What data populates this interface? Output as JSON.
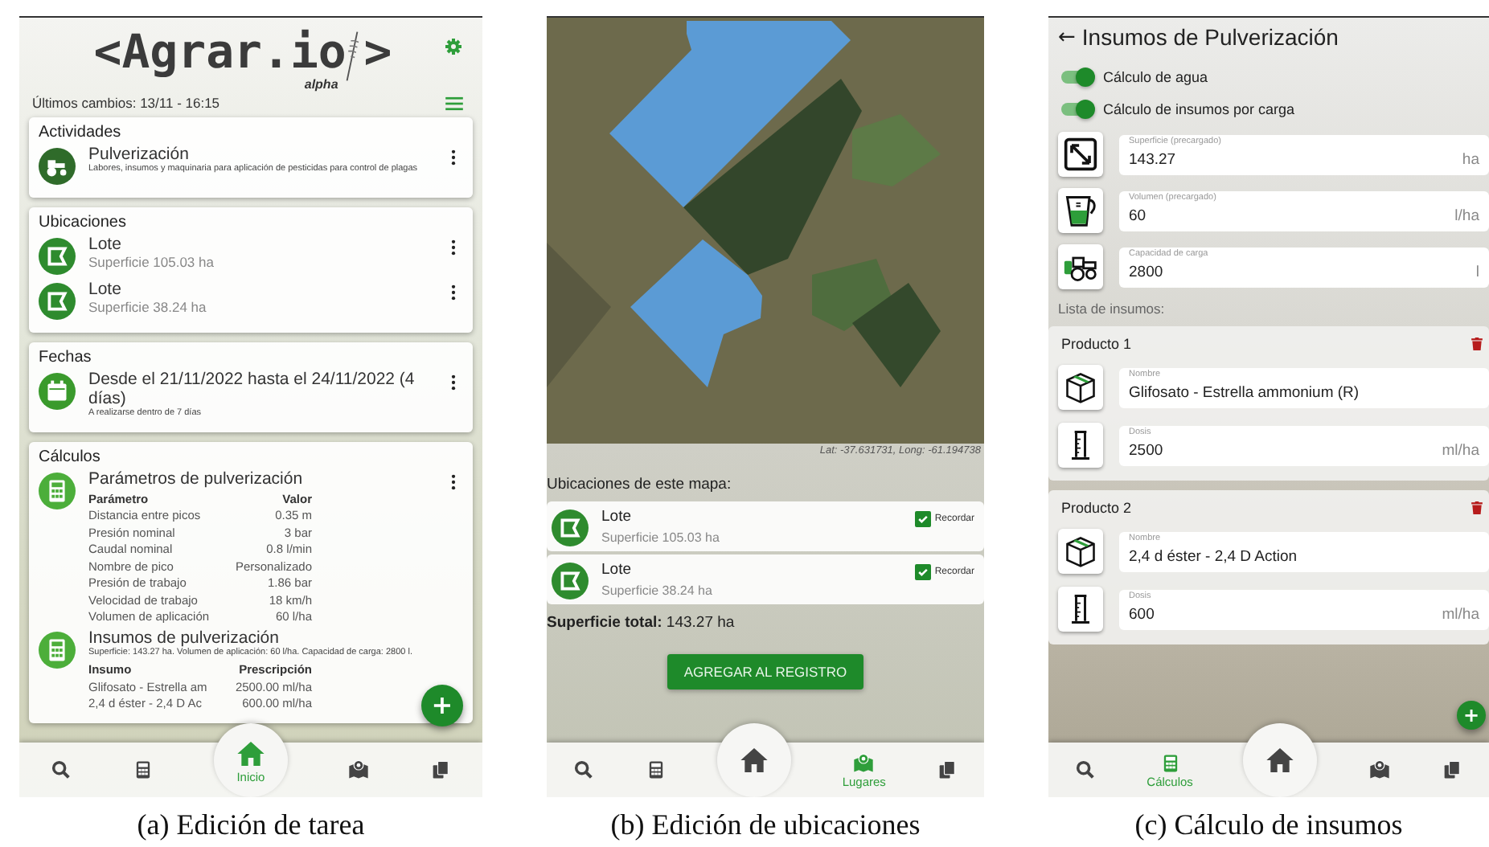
{
  "panel_a": {
    "caption": "(a) Edición de tarea",
    "logo": {
      "text": "<Agrar.io",
      "tag": "alpha",
      "close": ">"
    },
    "last_changes": "Últimos cambios: 13/11 - 16:15",
    "cards": [
      {
        "title": "Actividades",
        "items": [
          {
            "kind": "tractor",
            "title": "Pulverización",
            "note": "Labores, insumos y maquinaria para aplicación de pesticidas para control de plagas",
            "menu": true
          }
        ]
      },
      {
        "title": "Ubicaciones",
        "items": [
          {
            "kind": "location",
            "title": "Lote",
            "subtitle": "Superficie 105.03 ha",
            "menu": true
          },
          {
            "kind": "location",
            "title": "Lote",
            "subtitle": "Superficie 38.24 ha",
            "menu": true
          }
        ]
      },
      {
        "title": "Fechas",
        "items": [
          {
            "kind": "calendar",
            "title": "Desde el 21/11/2022 hasta el 24/11/2022 (4 días)",
            "note": "A realizarse dentro de 7 días",
            "menu": true
          }
        ]
      },
      {
        "title": "Cálculos",
        "items": [
          {
            "kind": "calculator",
            "title": "Parámetros de pulverización",
            "menu": true,
            "table": {
              "columns": [
                "Parámetro",
                "Valor"
              ],
              "rows": [
                [
                  "Distancia entre picos",
                  "0.35 m"
                ],
                [
                  "Presión nominal",
                  "3 bar"
                ],
                [
                  "Caudal nominal",
                  "0.8 l/min"
                ],
                [
                  "Nombre de pico",
                  "Personalizado"
                ],
                [
                  "Presión de trabajo",
                  "1.86 bar"
                ],
                [
                  "Velocidad de trabajo",
                  "18 km/h"
                ],
                [
                  "Volumen de aplicación",
                  "60 l/ha"
                ]
              ]
            }
          },
          {
            "kind": "calculator",
            "title": "Insumos de pulverización",
            "note": "Superficie: 143.27 ha. Volumen de aplicación: 60 l/ha. Capacidad de carga: 2800 l.",
            "menu": false,
            "table": {
              "columns": [
                "Insumo",
                "Prescripción"
              ],
              "rows": [
                [
                  "Glifosato - Estrella am",
                  "2500.00 ml/ha"
                ],
                [
                  "2,4 d éster - 2,4 D Ac",
                  "600.00 ml/ha"
                ]
              ]
            }
          }
        ]
      }
    ],
    "fab": "+",
    "nav": [
      {
        "kind": "search",
        "selected": false
      },
      {
        "kind": "calculator",
        "selected": false
      },
      {
        "kind": "home",
        "selected": true,
        "label": "Inicio"
      },
      {
        "kind": "map",
        "selected": false
      },
      {
        "kind": "documents",
        "selected": false
      }
    ]
  },
  "panel_b": {
    "caption": "(b) Edición de ubicaciones",
    "coordinates": "Lat: -37.631731, Long: -61.194738",
    "heading": "Ubicaciones de este mapa:",
    "locations": [
      {
        "title": "Lote",
        "subtitle": "Superficie 105.03 ha",
        "checkbox": "Recordar",
        "checked": true
      },
      {
        "title": "Lote",
        "subtitle": "Superficie 38.24 ha",
        "checkbox": "Recordar",
        "checked": true
      }
    ],
    "total": "**Superficie total:** 143.27 ha",
    "button": "AGREGAR AL REGISTRO",
    "nav": [
      {
        "kind": "search",
        "selected": false
      },
      {
        "kind": "calculator",
        "selected": false
      },
      {
        "kind": "home",
        "selected": false
      },
      {
        "kind": "map",
        "selected": true,
        "label": "Lugares"
      },
      {
        "kind": "documents",
        "selected": false
      }
    ]
  },
  "panel_c": {
    "caption": "(c) Cálculo de insumos",
    "back": "←",
    "title": "Insumos de Pulverización",
    "toggles": [
      {
        "label": "Cálculo de agua",
        "on": true
      },
      {
        "label": "Cálculo de insumos por carga",
        "on": true
      }
    ],
    "fields": [
      {
        "kind": "resize",
        "label": "Superficie (precargado)",
        "value": "143.27",
        "unit": "ha"
      },
      {
        "kind": "jug",
        "label": "Volumen (precargado)",
        "value": "60",
        "unit": "l/ha"
      },
      {
        "kind": "tractor",
        "label": "Capacidad de carga",
        "value": "2800",
        "unit": "l"
      }
    ],
    "list_label": "Lista de insumos:",
    "products": [
      {
        "title": "Producto 1",
        "fields": [
          {
            "kind": "box",
            "label": "Nombre",
            "value": "Glifosato - Estrella ammonium (R)"
          },
          {
            "kind": "cylinder",
            "label": "Dosis",
            "value": "2500",
            "unit": "ml/ha"
          }
        ]
      },
      {
        "title": "Producto 2",
        "fields": [
          {
            "kind": "box",
            "label": "Nombre",
            "value": "2,4 d éster - 2,4 D Action"
          },
          {
            "kind": "cylinder",
            "label": "Dosis",
            "value": "600",
            "unit": "ml/ha"
          }
        ]
      }
    ],
    "fab": "+",
    "nav": [
      {
        "kind": "search",
        "selected": false
      },
      {
        "kind": "calculator",
        "selected": true,
        "label": "Cálculos"
      },
      {
        "kind": "home",
        "selected": false
      },
      {
        "kind": "map",
        "selected": false
      },
      {
        "kind": "documents",
        "selected": false
      }
    ]
  }
}
